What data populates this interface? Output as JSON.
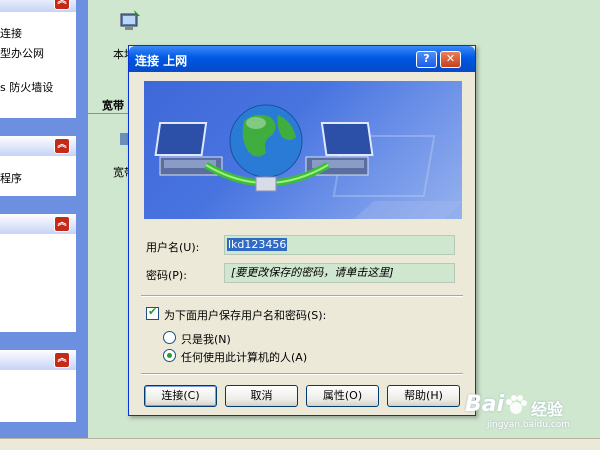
{
  "taskpane": {
    "network_tasks": [
      "连接",
      "型办公网",
      "s 防火墙设"
    ],
    "other_items": [
      "程序"
    ]
  },
  "explorer": {
    "item1_label": "本地",
    "section_label": "宽带",
    "item2_label": "宽带"
  },
  "dialog": {
    "title": "连接 上网",
    "help_button": "?",
    "close_button": "✕",
    "username_label": "用户名(U):",
    "username_value": "lkd123456",
    "password_label": "密码(P):",
    "password_value": "[要更改保存的密码，请单击这里]",
    "save_checkbox_label": "为下面用户保存用户名和密码(S):",
    "save_checked": true,
    "radio_me_label": "只是我(N)",
    "radio_anyone_label": "任何使用此计算机的人(A)",
    "selected_radio": "anyone",
    "buttons": {
      "connect": "连接(C)",
      "cancel": "取消",
      "properties": "属性(O)",
      "help": "帮助(H)"
    }
  },
  "watermark": {
    "brand": "Bai",
    "brand2": "经验",
    "url": "jingyan.baidu.com"
  },
  "colors": {
    "taskpane_bg": "#6c8fe0",
    "title_bar": "#0058e6",
    "dialog_bg": "#ece9d8",
    "field_bg": "#cfe6cf"
  }
}
